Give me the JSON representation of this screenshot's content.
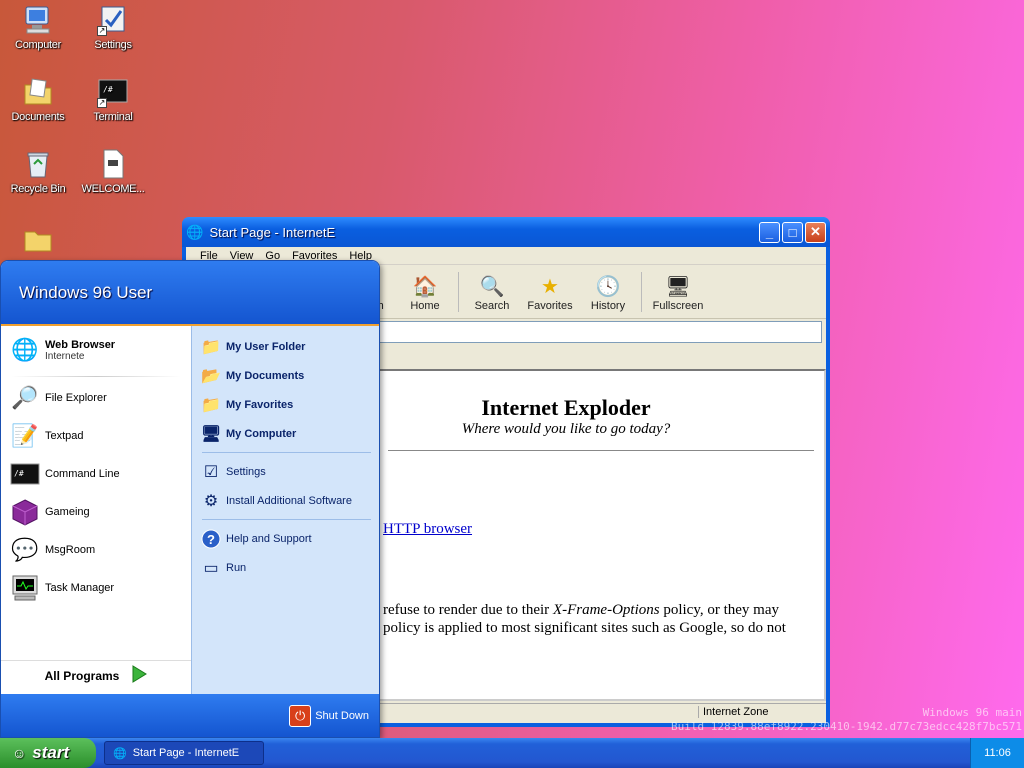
{
  "desktop": {
    "icons": [
      {
        "label": "Computer",
        "icon": "computer-icon"
      },
      {
        "label": "Settings",
        "icon": "settings-icon"
      },
      {
        "label": "Documents",
        "icon": "documents-icon"
      },
      {
        "label": "Terminal",
        "icon": "terminal-icon"
      },
      {
        "label": "Recycle Bin",
        "icon": "recycle-bin-icon"
      },
      {
        "label": "WELCOME...",
        "icon": "text-file-icon"
      },
      {
        "label": "",
        "icon": "folder-icon"
      }
    ]
  },
  "window": {
    "title": "Start Page - InternetE",
    "menu": [
      "File",
      "View",
      "Go",
      "Favorites",
      "Help"
    ],
    "toolbar": [
      "esh",
      "Home",
      "Search",
      "Favorites",
      "History",
      "Fullscreen"
    ],
    "content": {
      "heading": "Internet Exploder",
      "tagline": "Where would you like to go today?",
      "link": "HTTP browser",
      "para1": "refuse to render due to their ",
      "para1_em": "X-Frame-Options",
      "para1_b": " policy, or they may",
      "para2": "policy is applied to most significant sites such as Google, so do not"
    },
    "status_zone": "Internet Zone"
  },
  "start_menu": {
    "user": "Windows 96 User",
    "left_items": [
      {
        "label": "Web Browser",
        "sub": "Internete",
        "icon": "globe-icon"
      },
      {
        "label": "File Explorer",
        "icon": "file-explorer-icon"
      },
      {
        "label": "Textpad",
        "icon": "notepad-icon"
      },
      {
        "label": "Command Line",
        "icon": "terminal-icon"
      },
      {
        "label": "Gameing",
        "icon": "cube-icon"
      },
      {
        "label": "MsgRoom",
        "icon": "chat-icon"
      },
      {
        "label": "Task Manager",
        "icon": "task-manager-icon"
      }
    ],
    "all_programs": "All Programs",
    "right_items": [
      {
        "label": "My User Folder",
        "icon": "folder-icon",
        "bold": true
      },
      {
        "label": "My Documents",
        "icon": "documents-icon",
        "bold": true
      },
      {
        "label": "My Favorites",
        "icon": "folder-icon",
        "bold": true
      },
      {
        "label": "My Computer",
        "icon": "computer-icon",
        "bold": true
      },
      {
        "label": "Settings",
        "icon": "settings-icon",
        "bold": false
      },
      {
        "label": "Install Additional Software",
        "icon": "install-icon",
        "bold": false
      },
      {
        "label": "Help and Support",
        "icon": "help-icon",
        "bold": false
      },
      {
        "label": "Run",
        "icon": "run-icon",
        "bold": false
      }
    ],
    "shutdown": "Shut Down"
  },
  "taskbar": {
    "start_label": "start",
    "task": "Start Page - InternetE",
    "clock": "11:06"
  },
  "watermark": {
    "line1": "Windows 96 main",
    "line2": "Build 12839.88ef8922.230410-1942.d77c73edcc428f7bc571"
  }
}
